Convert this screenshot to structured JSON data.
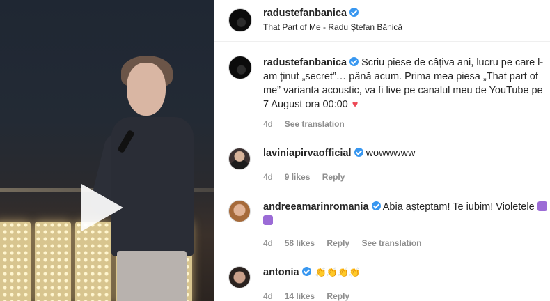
{
  "post": {
    "author": "radustefanbanica",
    "subtitle": "That Part of Me - Radu Ștefan Bănică"
  },
  "caption": {
    "author": "radustefanbanica",
    "text": "Scriu piese de câțiva ani, lucru pe care l-am ținut „secret”… până acum. Prima mea piesa „That part of me” varianta acoustic, va fi live pe canalul meu de YouTube pe 7 August ora 00:00",
    "heart": "♥",
    "time": "4d",
    "see_translation": "See translation"
  },
  "comments": [
    {
      "author": "laviniapirvaofficial",
      "text": "wowwwww",
      "time": "4d",
      "likes": "9 likes",
      "reply": "Reply"
    },
    {
      "author": "andreeamarinromania",
      "text": "Abia așteptam! Te iubim! Violetele",
      "time": "4d",
      "likes": "58 likes",
      "reply": "Reply",
      "see_translation": "See translation"
    },
    {
      "author": "antonia",
      "text": "👏👏👏👏",
      "time": "4d",
      "likes": "14 likes",
      "reply": "Reply"
    }
  ],
  "colors": {
    "verified": "#3897f0",
    "heart": "#ed4956",
    "meta": "#8e8e8e"
  },
  "icons": {
    "verified": "verified-badge-icon",
    "play": "play-icon"
  }
}
